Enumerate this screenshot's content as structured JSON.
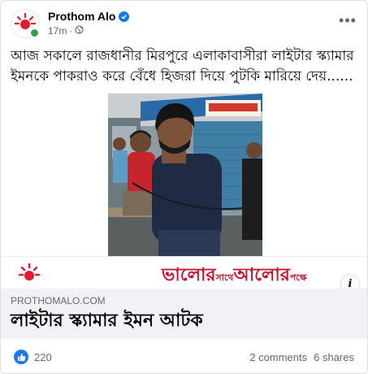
{
  "post": {
    "page_name": "Prothom Alo",
    "time": "17m",
    "separator": "·",
    "audience_icon": "globe-icon",
    "caption": "আজ সকালে রাজধানীর মিরপুরে এলাকাবাসীরা লাইটার স্ক্যামার ইমনকে পাকরাও করে বেঁধে হিজরা দিয়ে পুটকি মারিয়ে দেয়......"
  },
  "banner": {
    "tagline_part1": "ভালোর",
    "tagline_small1": "সাথে",
    "tagline_part2": "আলোর",
    "tagline_small2": "পক্ষে",
    "info_label": "i"
  },
  "link": {
    "domain": "PROTHOMALO.COM",
    "title": "লাইটার স্ক্যামার ইমন আটক"
  },
  "footer": {
    "reactions": "220",
    "comments": "2 comments",
    "shares": "6 shares"
  },
  "colors": {
    "brand_red": "#c8102e",
    "facebook_blue": "#1877f2",
    "online_green": "#31a24c"
  }
}
